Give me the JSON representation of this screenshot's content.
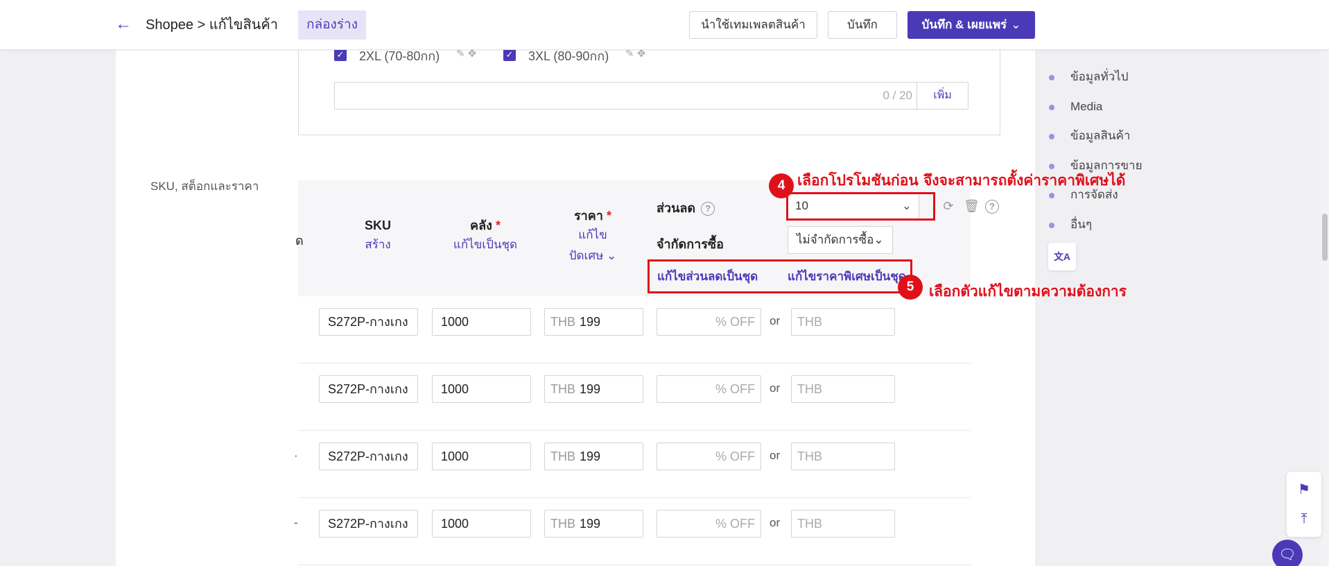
{
  "header": {
    "breadcrumb": "Shopee > แก้ไขสินค้า",
    "draft_label": "กล่องร่าง",
    "template_button": "นำใช้เทมเพลตสินค้า",
    "save_button": "บันทึก",
    "publish_button": "บันทึก & เผยแพร่"
  },
  "variants": {
    "options": [
      {
        "label": "2XL (70-80กก)",
        "checked": true
      },
      {
        "label": "3XL (80-90กก)",
        "checked": true
      }
    ],
    "input_counter": "0 / 20",
    "add_button": "เพิ่ม"
  },
  "sku_section": {
    "label": "SKU, สต็อกและราคา",
    "cut_header_tail": "ด",
    "columns": {
      "sku": {
        "title": "SKU",
        "action": "สร้าง"
      },
      "stock": {
        "title": "คลัง",
        "required": "*",
        "action": "แก้ไขเป็นชุด"
      },
      "price": {
        "title": "ราคา",
        "required": "*",
        "action": "แก้ไข",
        "rounding": "ปัดเศษ"
      }
    },
    "discount_label": "ส่วนลด",
    "promo_value": "10",
    "purchase_limit_label": "จำกัดการซื้อ",
    "purchase_limit_value": "ไม่จำกัดการซื้อ",
    "bulk_discount_link": "แก้ไขส่วนลดเป็นชุด",
    "bulk_special_price_link": "แก้ไขราคาพิเศษเป็นชุด",
    "rows": [
      {
        "edge": "",
        "sku": "S272P-กางเกง",
        "stock": "1000",
        "currency": "THB",
        "price": "199",
        "pct_placeholder": "% OFF",
        "or": "or",
        "special_placeholder": "THB"
      },
      {
        "edge": "",
        "sku": "S272P-กางเกง",
        "stock": "1000",
        "currency": "THB",
        "price": "199",
        "pct_placeholder": "% OFF",
        "or": "or",
        "special_placeholder": "THB"
      },
      {
        "edge": "·",
        "sku": "S272P-กางเกง",
        "stock": "1000",
        "currency": "THB",
        "price": "199",
        "pct_placeholder": "% OFF",
        "or": "or",
        "special_placeholder": "THB"
      },
      {
        "edge": "-",
        "sku": "S272P-กางเกง",
        "stock": "1000",
        "currency": "THB",
        "price": "199",
        "pct_placeholder": "% OFF",
        "or": "or",
        "special_placeholder": "THB"
      }
    ]
  },
  "annotations": {
    "step4_number": "4",
    "step4_text": "เลือกโปรโมชันก่อน จึงจะสามารถตั้งค่าราคาพิเศษได้",
    "step5_number": "5",
    "step5_text": "เลือกตัวแก้ไขตามความต้องการ",
    "color": "#e0101a"
  },
  "side_nav": {
    "items": [
      "ข้อมูลทั่วไป",
      "Media",
      "ข้อมูลสินค้า",
      "ข้อมูลการขาย",
      "การจัดส่ง",
      "อื่นๆ"
    ]
  },
  "icons": {
    "back": "arrow-left-icon",
    "translate": "translate-icon",
    "feedback": "flag-icon",
    "top": "back-to-top-icon",
    "chat": "chat-icon"
  },
  "colors": {
    "accent": "#4b3ab8",
    "draft_bg": "#e9e3f8"
  }
}
